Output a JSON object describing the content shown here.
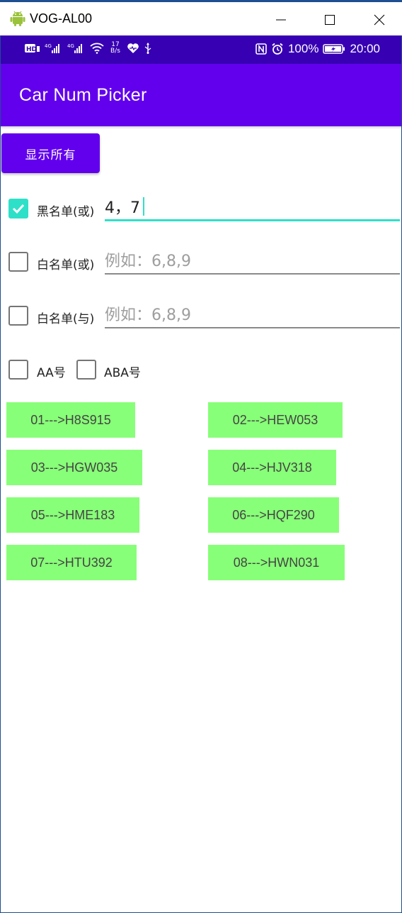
{
  "window": {
    "title": "VOG-AL00",
    "minimize_symbol": "—",
    "maximize_symbol": "☐",
    "close_symbol": "✕"
  },
  "status_bar": {
    "net_speed_value": "17",
    "net_speed_unit": "B/s",
    "battery": "100%",
    "time": "20:00",
    "left_icons": [
      "hd-icon",
      "signal-4g-icon",
      "signal-4g-icon",
      "wifi-icon",
      "heart-icon",
      "usb-icon"
    ],
    "right_icons": [
      "nfc-icon",
      "alarm-icon",
      "battery-charging-icon"
    ]
  },
  "app_bar": {
    "title": "Car Num Picker",
    "color": "#6200ee",
    "status_color": "#3700b3"
  },
  "show_all_button": "显示所有",
  "filters": [
    {
      "label": "黑名单(或)",
      "checked": true,
      "value": "4，7",
      "placeholder": ""
    },
    {
      "label": "白名单(或)",
      "checked": false,
      "value": "",
      "placeholder": "例如：6,8,9"
    },
    {
      "label": "白名单(与)",
      "checked": false,
      "value": "",
      "placeholder": "例如：6,8,9"
    }
  ],
  "pattern_options": [
    {
      "label": "AA号",
      "checked": false
    },
    {
      "label": "ABA号",
      "checked": false
    }
  ],
  "accent_color": "#2fe0c8",
  "plate_color": "#88ff78",
  "plates": [
    "01--->H8S915",
    "02--->HEW053",
    "03--->HGW035",
    "04--->HJV318",
    "05--->HME183",
    "06--->HQF290",
    "07--->HTU392",
    "08--->HWN031"
  ]
}
